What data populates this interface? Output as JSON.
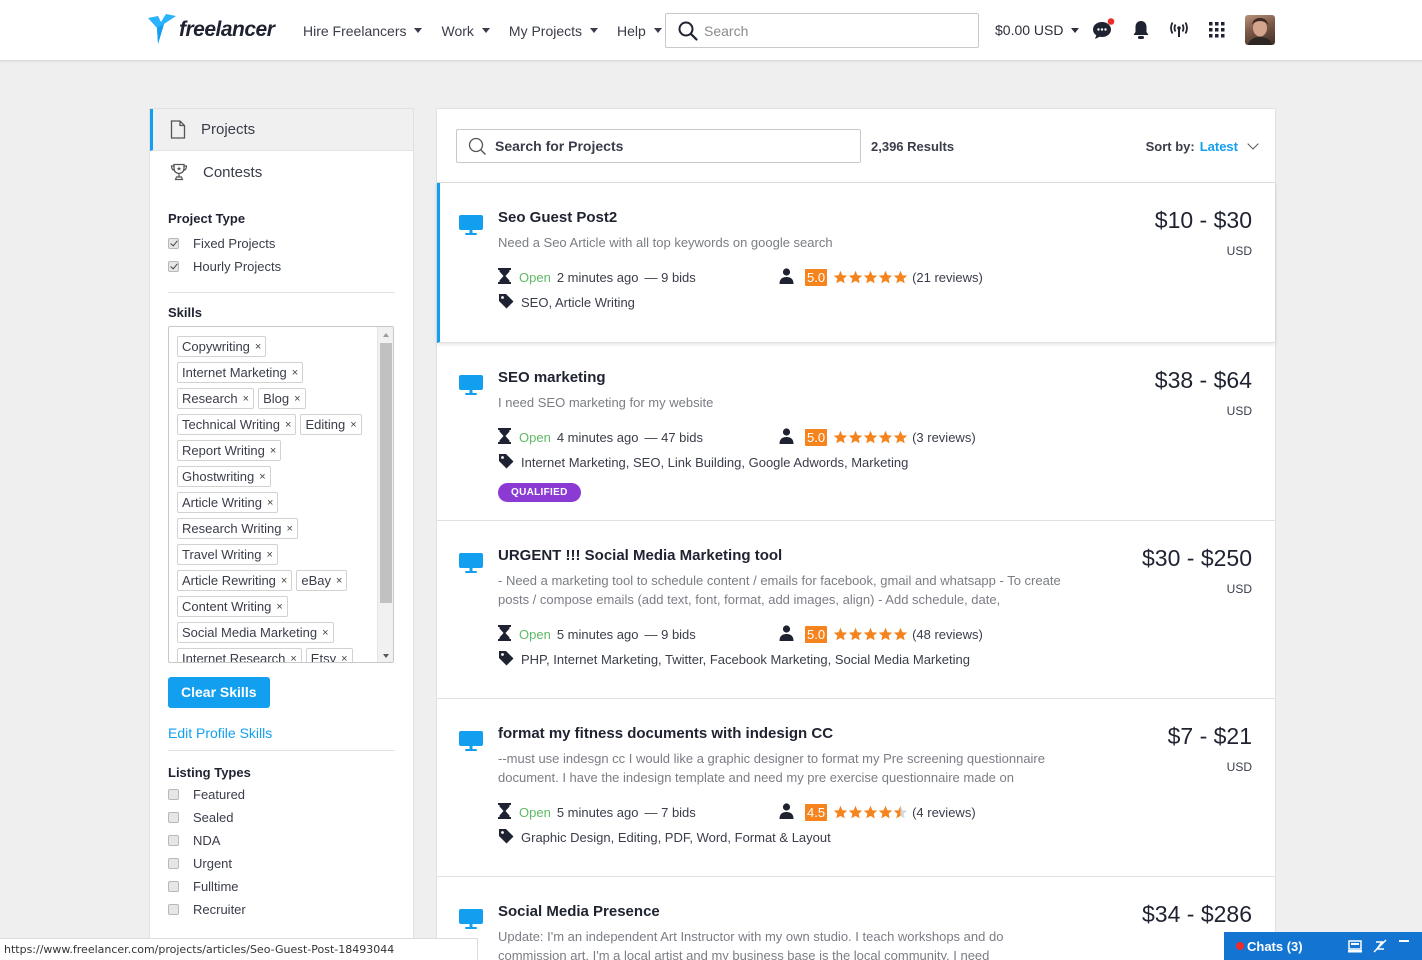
{
  "header": {
    "logo_text": "freelancer",
    "nav": [
      {
        "label": "Hire Freelancers"
      },
      {
        "label": "Work"
      },
      {
        "label": "My Projects"
      },
      {
        "label": "Help"
      }
    ],
    "search_placeholder": "Search",
    "balance": "$0.00 USD",
    "icons": [
      "chat-icon",
      "bell-icon",
      "broadcast-icon",
      "apps-grid-icon"
    ],
    "notification_dot_color": "#ee2b2b"
  },
  "sidebar": {
    "tabs": [
      {
        "label": "Projects",
        "icon": "document-icon",
        "active": true
      },
      {
        "label": "Contests",
        "icon": "trophy-icon",
        "active": false
      }
    ],
    "project_type": {
      "heading": "Project Type",
      "options": [
        {
          "label": "Fixed Projects",
          "checked": true
        },
        {
          "label": "Hourly Projects",
          "checked": true
        }
      ]
    },
    "skills": {
      "heading": "Skills",
      "tags": [
        "Copywriting",
        "Internet Marketing",
        "Research",
        "Blog",
        "Technical Writing",
        "Editing",
        "Report Writing",
        "Ghostwriting",
        "Article Writing",
        "Research Writing",
        "Travel Writing",
        "Article Rewriting",
        "eBay",
        "Content Writing",
        "Social Media Marketing",
        "Internet Research",
        "Etsy"
      ],
      "remove_glyph": "×",
      "clear_label": "Clear Skills",
      "edit_label": "Edit Profile Skills"
    },
    "listing_types": {
      "heading": "Listing Types",
      "options": [
        {
          "label": "Featured",
          "checked": false
        },
        {
          "label": "Sealed",
          "checked": false
        },
        {
          "label": "NDA",
          "checked": false
        },
        {
          "label": "Urgent",
          "checked": false
        },
        {
          "label": "Fulltime",
          "checked": false
        },
        {
          "label": "Recruiter",
          "checked": false
        }
      ]
    }
  },
  "main": {
    "search_placeholder": "Search for Projects",
    "results": "2,396 Results",
    "sort_label": "Sort by:",
    "sort_value": "Latest",
    "projects": [
      {
        "title": "Seo Guest Post2",
        "description": "Need a Seo Article with all top keywords on google search",
        "status": "Open",
        "time": "2 minutes ago",
        "bids": "— 9 bids",
        "rating": "5.0",
        "stars": 5,
        "reviews": "(21 reviews)",
        "skills": "SEO, Article Writing",
        "price": "$10 - $30",
        "currency": "USD",
        "badge": null,
        "highlighted": true
      },
      {
        "title": "SEO marketing",
        "description": "I need SEO marketing for my website",
        "status": "Open",
        "time": "4 minutes ago",
        "bids": "— 47 bids",
        "rating": "5.0",
        "stars": 5,
        "reviews": "(3 reviews)",
        "skills": "Internet Marketing, SEO, Link Building, Google Adwords, Marketing",
        "price": "$38 - $64",
        "currency": "USD",
        "badge": "QUALIFIED",
        "highlighted": false
      },
      {
        "title": "URGENT !!! Social Media Marketing tool",
        "description": "- Need a marketing tool to schedule content / emails for facebook, gmail and whatsapp - To create posts / compose emails (add text, font, format, add images, align) - Add schedule, date,",
        "status": "Open",
        "time": "5 minutes ago",
        "bids": "— 9 bids",
        "rating": "5.0",
        "stars": 5,
        "reviews": "(48 reviews)",
        "skills": "PHP, Internet Marketing, Twitter, Facebook Marketing, Social Media Marketing",
        "price": "$30 - $250",
        "currency": "USD",
        "badge": null,
        "highlighted": false
      },
      {
        "title": "format my fitness documents with indesign CC",
        "description": "--must use indesgn cc I would like a graphic designer to format my Pre screening questionnaire document. I have the indesign template and need my pre exercise questionnaire made on",
        "status": "Open",
        "time": "5 minutes ago",
        "bids": "— 7 bids",
        "rating": "4.5",
        "stars": 4.5,
        "reviews": "(4 reviews)",
        "skills": "Graphic Design, Editing, PDF, Word, Format & Layout",
        "price": "$7 - $21",
        "currency": "USD",
        "badge": null,
        "highlighted": false
      },
      {
        "title": "Social Media Presence",
        "description": "Update: I'm an independent Art Instructor with my own studio. I teach workshops and do commission art. I'm a local artist and my business base is the local community. I need",
        "price": "$34 - $286",
        "highlighted": false
      }
    ]
  },
  "status_bar": {
    "url": "https://www.freelancer.com/projects/articles/Seo-Guest-Post-18493044"
  },
  "chat": {
    "label": "Chats (3)",
    "icons": [
      "inbox-icon",
      "mute-icon",
      "minimize-icon"
    ]
  },
  "colors": {
    "brand": "#139ff0",
    "rating": "#f5841f",
    "open": "#5dbb63",
    "qualified": "#8b3bd4",
    "chat_bar": "#1374d1"
  }
}
